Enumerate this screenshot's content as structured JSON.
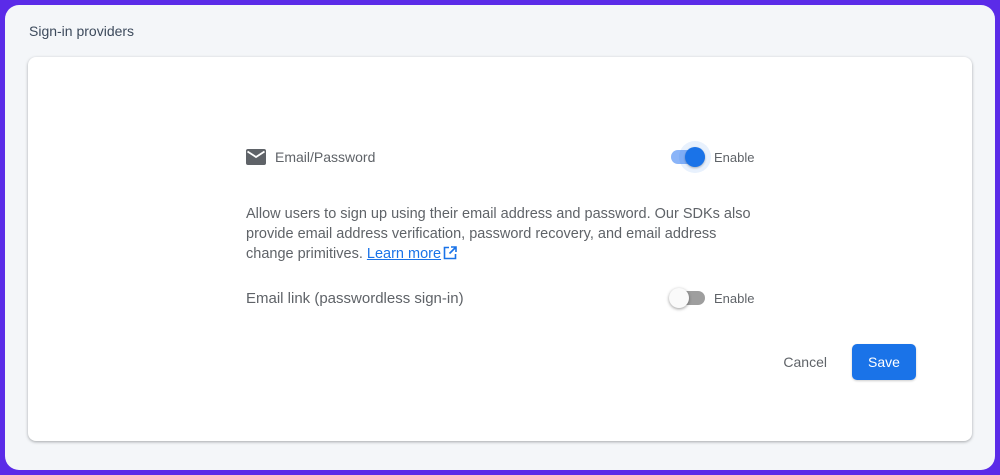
{
  "section": {
    "title": "Sign-in providers"
  },
  "providers": {
    "email_password": {
      "icon": "mail-icon",
      "label": "Email/Password",
      "toggle_label": "Enable",
      "enabled": true
    },
    "description": {
      "text": "Allow users to sign up using their email address and password. Our SDKs also provide email address verification, password recovery, and email address change primitives.",
      "link_label": "Learn more",
      "link_icon": "external-link-icon"
    },
    "email_link": {
      "label": "Email link (passwordless sign-in)",
      "toggle_label": "Enable",
      "enabled": false
    }
  },
  "actions": {
    "cancel_label": "Cancel",
    "save_label": "Save"
  },
  "colors": {
    "accent": "#1a73e8",
    "frame": "#5b2be8",
    "background": "#f4f6f9"
  }
}
